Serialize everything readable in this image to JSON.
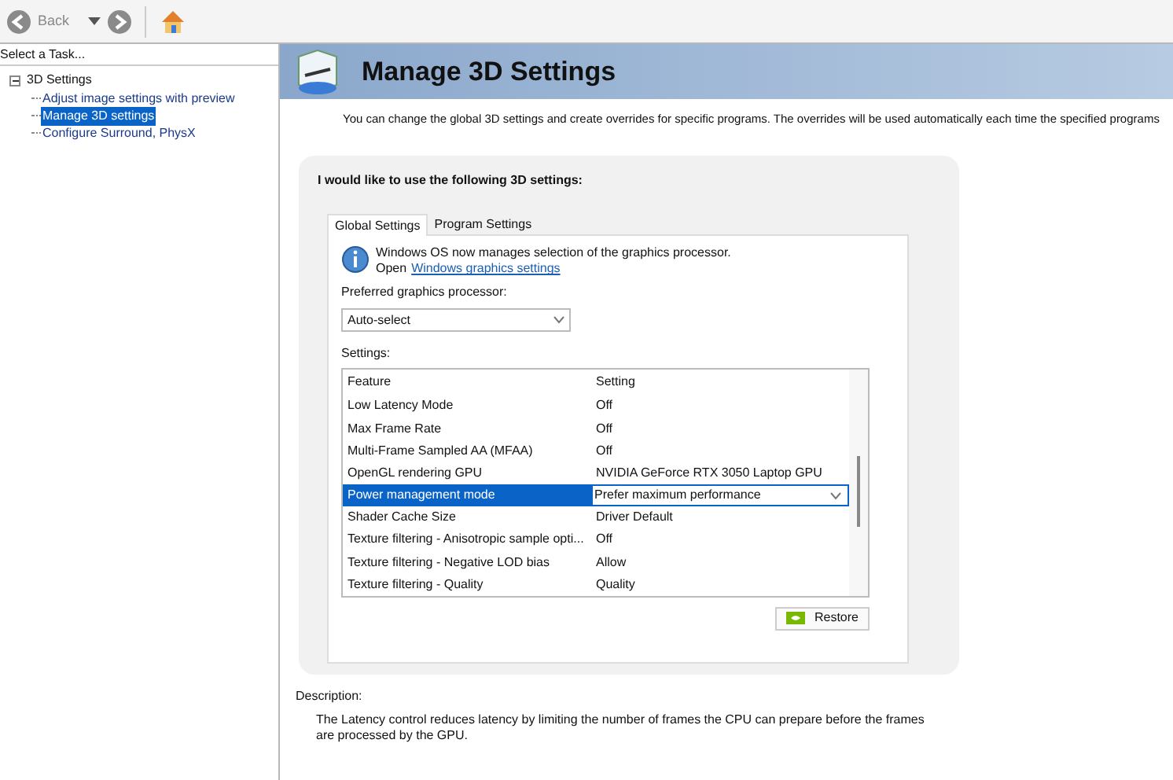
{
  "toolbar": {
    "back_label": "Back"
  },
  "sidebar": {
    "title": "Select a Task...",
    "tree": [
      {
        "label": "3D Settings",
        "expanded": true,
        "selected": false,
        "children": [
          {
            "label": "Adjust image settings with preview",
            "selected": false
          },
          {
            "label": "Manage 3D settings",
            "selected": true
          },
          {
            "label": "Configure Surround, PhysX",
            "selected": false
          }
        ]
      }
    ]
  },
  "header": {
    "title": "Manage 3D Settings"
  },
  "intro": "You can change the global 3D settings and create overrides for specific programs. The overrides will be used automatically each time the specified programs",
  "panel": {
    "title": "I would like to use the following 3D settings:",
    "tabs": [
      {
        "label": "Global Settings",
        "selected": true
      },
      {
        "label": "Program Settings",
        "selected": false
      }
    ],
    "notice": {
      "text": "Windows OS now manages selection of the graphics processor.",
      "open_label": "Open",
      "link": "Windows graphics settings"
    },
    "processor_label": "Preferred graphics processor:",
    "processor_value": "Auto-select",
    "settings_label": "Settings:",
    "table": {
      "columns": [
        "Feature",
        "Setting"
      ],
      "rows": [
        {
          "feature": "Low Latency Mode",
          "setting": "Off",
          "selected": false
        },
        {
          "feature": "Max Frame Rate",
          "setting": "Off",
          "selected": false
        },
        {
          "feature": "Multi-Frame Sampled AA (MFAA)",
          "setting": "Off",
          "selected": false
        },
        {
          "feature": "OpenGL rendering GPU",
          "setting": "NVIDIA GeForce RTX 3050 Laptop GPU",
          "selected": false
        },
        {
          "feature": "Power management mode",
          "setting": "Prefer maximum performance",
          "selected": true
        },
        {
          "feature": "Shader Cache Size",
          "setting": "Driver Default",
          "selected": false
        },
        {
          "feature": "Texture filtering - Anisotropic sample opti...",
          "setting": "Off",
          "selected": false
        },
        {
          "feature": "Texture filtering - Negative LOD bias",
          "setting": "Allow",
          "selected": false
        },
        {
          "feature": "Texture filtering - Quality",
          "setting": "Quality",
          "selected": false
        }
      ]
    },
    "restore_label": "Restore"
  },
  "description": {
    "label": "Description:",
    "text": "The Latency control reduces latency by limiting the number of frames the CPU can prepare before the frames are processed by the GPU."
  }
}
